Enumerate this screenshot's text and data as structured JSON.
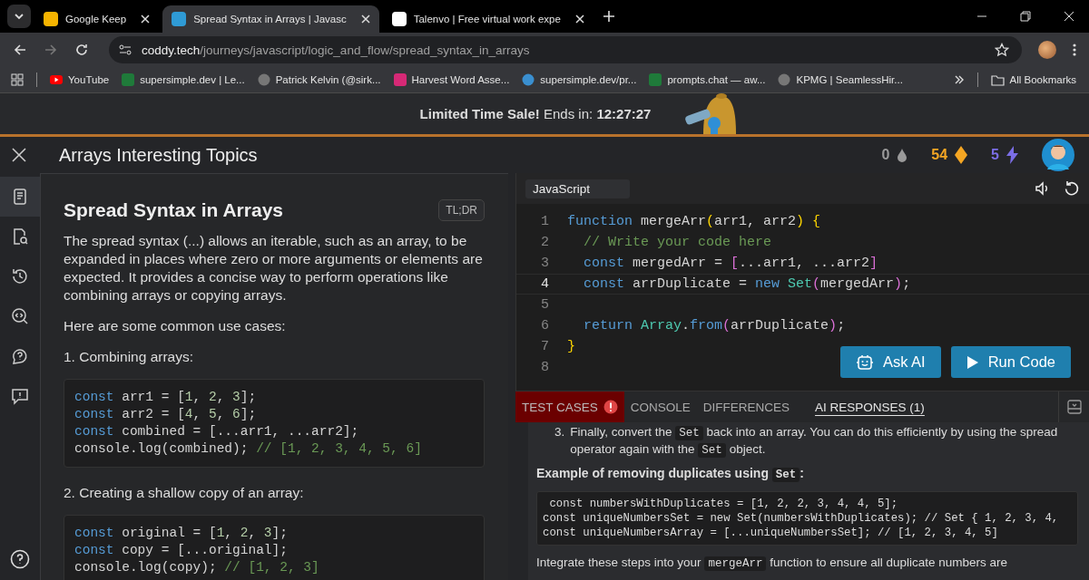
{
  "browser": {
    "tabs": [
      {
        "title": "Google Keep",
        "selected": false
      },
      {
        "title": "Spread Syntax in Arrays | Javasc",
        "selected": true
      },
      {
        "title": "Talenvo | Free virtual work expe",
        "selected": false
      }
    ],
    "url": {
      "host": "coddy.tech",
      "path": "/journeys/javascript/logic_and_flow/spread_syntax_in_arrays"
    },
    "bookmarks": [
      "YouTube",
      "supersimple.dev | Le...",
      "Patrick Kelvin (@sirk...",
      "Harvest Word Asse...",
      "supersimple.dev/pr...",
      "prompts.chat — aw...",
      "KPMG | SeamlessHir..."
    ],
    "all_bookmarks": "All Bookmarks"
  },
  "promo": {
    "text": "**Limited Time Sale!** Ends in: **12:27:27**"
  },
  "header": {
    "title": "Arrays Interesting Topics",
    "stats": [
      {
        "value": "0",
        "kind": "drops"
      },
      {
        "value": "54",
        "kind": "gems"
      },
      {
        "value": "5",
        "kind": "energy"
      }
    ]
  },
  "sidebar": {
    "items": [
      {
        "selected": true
      },
      {
        "selected": false
      },
      {
        "selected": false
      },
      {
        "selected": false
      },
      {
        "selected": false
      },
      {
        "selected": false
      }
    ]
  },
  "lesson": {
    "title": "Spread Syntax in Arrays",
    "badge": "TL;DR",
    "blocks": [
      {
        "kind": "p",
        "text": "The spread syntax (...) allows an iterable, such as an array, to be expanded in places where zero or more arguments or elements are expected. It provides a concise way to perform operations like combining arrays or copying arrays."
      },
      {
        "kind": "p",
        "text": "Here are some common use cases:"
      },
      {
        "kind": "p",
        "text": "1. Combining arrays:"
      },
      {
        "kind": "code",
        "lines": [
          [
            {
              "text": "const",
              "kind": "keyword"
            },
            {
              "text": " arr1 = [",
              "kind": "plain"
            },
            {
              "text": "1",
              "kind": "number"
            },
            {
              "text": ", ",
              "kind": "plain"
            },
            {
              "text": "2",
              "kind": "number"
            },
            {
              "text": ", ",
              "kind": "plain"
            },
            {
              "text": "3",
              "kind": "number"
            },
            {
              "text": "];",
              "kind": "plain"
            }
          ],
          [
            {
              "text": "const",
              "kind": "keyword"
            },
            {
              "text": " arr2 = [",
              "kind": "plain"
            },
            {
              "text": "4",
              "kind": "number"
            },
            {
              "text": ", ",
              "kind": "plain"
            },
            {
              "text": "5",
              "kind": "number"
            },
            {
              "text": ", ",
              "kind": "plain"
            },
            {
              "text": "6",
              "kind": "number"
            },
            {
              "text": "];",
              "kind": "plain"
            }
          ],
          [
            {
              "text": "const",
              "kind": "keyword"
            },
            {
              "text": " combined = [...arr1, ...arr2];",
              "kind": "plain"
            }
          ],
          [
            {
              "text": "console.log(combined);",
              "kind": "plain"
            },
            {
              "text": " // [1, 2, 3, 4, 5, 6]",
              "kind": "comment"
            }
          ]
        ]
      },
      {
        "kind": "p",
        "text": "2. Creating a shallow copy of an array:"
      },
      {
        "kind": "code",
        "lines": [
          [
            {
              "text": "const",
              "kind": "keyword"
            },
            {
              "text": " original = [",
              "kind": "plain"
            },
            {
              "text": "1",
              "kind": "number"
            },
            {
              "text": ", ",
              "kind": "plain"
            },
            {
              "text": "2",
              "kind": "number"
            },
            {
              "text": ", ",
              "kind": "plain"
            },
            {
              "text": "3",
              "kind": "number"
            },
            {
              "text": "];",
              "kind": "plain"
            }
          ],
          [
            {
              "text": "const",
              "kind": "keyword"
            },
            {
              "text": " copy = [...original];",
              "kind": "plain"
            }
          ],
          [
            {
              "text": "console.log(copy);",
              "kind": "plain"
            },
            {
              "text": " // [1, 2, 3]",
              "kind": "comment"
            }
          ]
        ]
      }
    ]
  },
  "editor": {
    "language": "JavaScript",
    "lines": [
      {
        "number": "1",
        "active": false,
        "tokens": [
          {
            "text": "function",
            "kind": "keyword"
          },
          {
            "text": " mergeArr",
            "kind": "plain"
          },
          {
            "text": "(",
            "kind": "bracket"
          },
          {
            "text": "arr1, arr2",
            "kind": "plain"
          },
          {
            "text": ")",
            "kind": "bracket"
          },
          {
            "text": " {",
            "kind": "bracket"
          }
        ]
      },
      {
        "number": "2",
        "active": false,
        "tokens": [
          {
            "text": "  // Write your code here",
            "kind": "comment"
          }
        ]
      },
      {
        "number": "3",
        "active": false,
        "tokens": [
          {
            "text": "  const",
            "kind": "keyword"
          },
          {
            "text": " mergedArr = ",
            "kind": "plain"
          },
          {
            "text": "[",
            "kind": "bracket2"
          },
          {
            "text": "...arr1, ...arr2",
            "kind": "plain"
          },
          {
            "text": "]",
            "kind": "bracket2"
          }
        ]
      },
      {
        "number": "4",
        "active": true,
        "tokens": [
          {
            "text": "  const",
            "kind": "keyword"
          },
          {
            "text": " arrDuplicate = ",
            "kind": "plain"
          },
          {
            "text": "new",
            "kind": "keyword"
          },
          {
            "text": " Set",
            "kind": "class"
          },
          {
            "text": "(",
            "kind": "bracket2"
          },
          {
            "text": "mergedArr",
            "kind": "plain"
          },
          {
            "text": ")",
            "kind": "bracket2"
          },
          {
            "text": ";",
            "kind": "plain"
          }
        ]
      },
      {
        "number": "5",
        "active": false
      },
      {
        "number": "6",
        "active": false,
        "tokens": [
          {
            "text": "  return",
            "kind": "keyword"
          },
          {
            "text": " Array",
            "kind": "class"
          },
          {
            "text": ".",
            "kind": "plain"
          },
          {
            "text": "from",
            "kind": "keyword"
          },
          {
            "text": "(",
            "kind": "bracket2"
          },
          {
            "text": "arrDuplicate",
            "kind": "plain"
          },
          {
            "text": ")",
            "kind": "bracket2"
          },
          {
            "text": ";",
            "kind": "plain"
          }
        ]
      },
      {
        "number": "7",
        "active": false,
        "tokens": [
          {
            "text": "}",
            "kind": "bracket"
          }
        ]
      },
      {
        "number": "8",
        "active": false
      }
    ],
    "buttons": [
      "Ask AI",
      "Run Code"
    ]
  },
  "output": {
    "tabs": [
      {
        "label": "TEST CASES",
        "selected": false,
        "failed": true
      },
      {
        "label": "CONSOLE",
        "selected": false,
        "failed": false
      },
      {
        "label": "DIFFERENCES",
        "selected": false,
        "failed": false
      },
      {
        "label": "AI RESPONSES (1)",
        "selected": true,
        "failed": false
      }
    ],
    "blocks": [
      {
        "kind": "li",
        "number": "3.",
        "parts": [
          {
            "text": "Finally, convert the ",
            "kind": "plain"
          },
          {
            "text": "Set",
            "kind": "code"
          },
          {
            "text": " back into an array. You can do this efficiently by using the spread operator again with the ",
            "kind": "plain"
          },
          {
            "text": "Set",
            "kind": "code"
          },
          {
            "text": " object.",
            "kind": "plain"
          }
        ]
      },
      {
        "kind": "heading",
        "parts": [
          {
            "text": "Example of removing duplicates using ",
            "kind": "plain"
          },
          {
            "text": "Set",
            "kind": "code"
          },
          {
            "text": ":",
            "kind": "plain"
          }
        ]
      },
      {
        "kind": "pre",
        "lines": [
          " const numbersWithDuplicates = [1, 2, 2, 3, 4, 4, 5];",
          "const uniqueNumbersSet = new Set(numbersWithDuplicates); // Set { 1, 2, 3, 4,",
          "const uniqueNumbersArray = [...uniqueNumbersSet]; // [1, 2, 3, 4, 5]"
        ]
      },
      {
        "kind": "p",
        "parts": [
          {
            "text": "Integrate these steps into your ",
            "kind": "plain"
          },
          {
            "text": "mergeArr",
            "kind": "code"
          },
          {
            "text": " function to ensure all duplicate numbers are",
            "kind": "plain"
          }
        ]
      }
    ]
  }
}
